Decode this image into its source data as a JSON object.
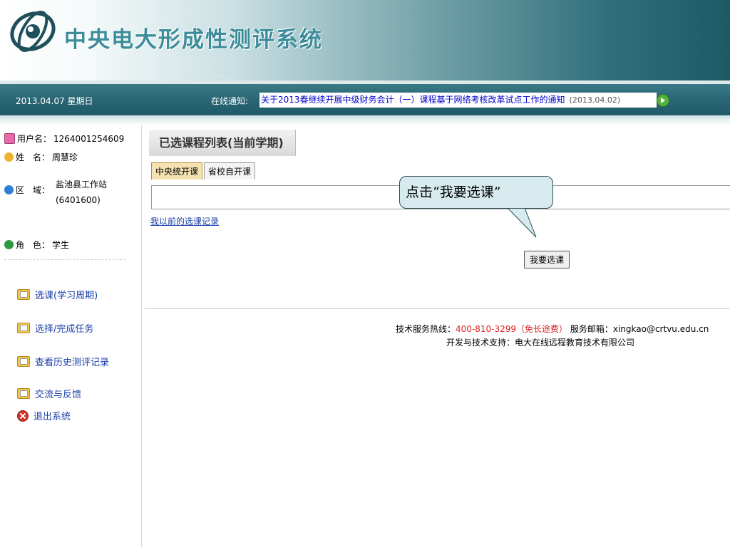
{
  "header": {
    "system_title": "中央电大形成性测评系统"
  },
  "infobar": {
    "date": "2013.04.07 星期日",
    "notice_label": "在线通知:",
    "notice_text": "关于2013春继续开展中级财务会计（一）课程基于网络考核改革试点工作的通知",
    "notice_date": "(2013.04.02)"
  },
  "user": {
    "username_label": "用户名：",
    "username": "1264001254609",
    "name_label": "姓　名：",
    "name": "周慧珍",
    "region_label": "区　域：",
    "region_name": "盐池县工作站",
    "region_code": "(6401600)",
    "role_label": "角　色：",
    "role": "学生"
  },
  "menu": [
    {
      "label": "选课(学习周期)",
      "icon": "folder-icon"
    },
    {
      "label": "选择/完成任务",
      "icon": "folder-icon"
    },
    {
      "label": "查看历史测评记录",
      "icon": "folder-icon"
    },
    {
      "label": "交流与反馈",
      "icon": "folder-icon"
    },
    {
      "label": "退出系统",
      "icon": "exit-icon"
    }
  ],
  "main": {
    "page_title": "已选课程列表(当前学期)",
    "tabs": [
      "中央统开课",
      "省校自开课"
    ],
    "history_link": "我以前的选课记录",
    "choose_button": "我要选课",
    "callout": "点击“我要选课”"
  },
  "footer": {
    "hotline_label": "技术服务热线：",
    "hotline": "400-810-3299（免长途费）",
    "email_label": " 服务邮箱：",
    "email": "xingkao@crtvu.edu.cn",
    "support": "开发与技术支持：电大在线远程教育技术有限公司"
  },
  "colors": {
    "brand": "#3c8c9a",
    "bar": "#2a6674",
    "link": "#1a3ea8",
    "hotline": "#dd2222"
  }
}
